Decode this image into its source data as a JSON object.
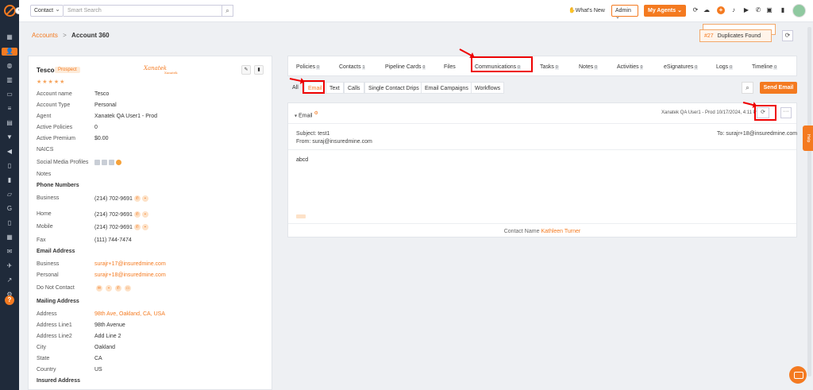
{
  "topbar": {
    "contact_select": "Contact",
    "search_placeholder": "Smart Search",
    "whats_new": "What's New",
    "admin_select": "Admin",
    "my_agents": "My Agents"
  },
  "breadcrumb": {
    "root": "Accounts",
    "sep": ">",
    "current": "Account 360"
  },
  "duplicates": {
    "count": "#27",
    "label": "Duplicates Found"
  },
  "account": {
    "name": "Tesco",
    "status": "Prospect",
    "rating_stars": "★★★★★",
    "logo_text": "Xanatek",
    "logo_sub": "Xanatek",
    "fields": [
      {
        "label": "Account name",
        "value": "Tesco"
      },
      {
        "label": "Account Type",
        "value": "Personal"
      },
      {
        "label": "Agent",
        "value": "Xanatek QA User1 - Prod"
      },
      {
        "label": "Active Policies",
        "value": "0"
      },
      {
        "label": "Active Premium",
        "value": "$0.00"
      },
      {
        "label": "NAICS",
        "value": ""
      },
      {
        "label": "Social Media Profiles",
        "value": ""
      },
      {
        "label": "Notes",
        "value": ""
      }
    ],
    "phone_section": "Phone Numbers",
    "phones": [
      {
        "label": "Business",
        "value": "(214) 702-9691"
      },
      {
        "label": "Home",
        "value": "(214) 702-9691"
      },
      {
        "label": "Mobile",
        "value": "(214) 702-9691"
      },
      {
        "label": "Fax",
        "value": "(111) 744-7474"
      }
    ],
    "email_section": "Email Address",
    "emails": [
      {
        "label": "Business",
        "value": "surajr+17@insuredmine.com"
      },
      {
        "label": "Personal",
        "value": "surajr+18@insuredmine.com"
      },
      {
        "label": "Do Not Contact",
        "value": ""
      }
    ],
    "mailing_section": "Mailing Address",
    "address": [
      {
        "label": "Address",
        "value": "98th Ave, Oakland, CA, USA"
      },
      {
        "label": "Address Line1",
        "value": "98th Avenue"
      },
      {
        "label": "Address Line2",
        "value": "Add Line 2"
      },
      {
        "label": "City",
        "value": "Oakland"
      },
      {
        "label": "State",
        "value": "CA"
      },
      {
        "label": "Country",
        "value": "US"
      }
    ],
    "insured_section": "Insured Address"
  },
  "tabs": [
    {
      "label": "Policies",
      "count": "0"
    },
    {
      "label": "Contacts",
      "count": "1"
    },
    {
      "label": "Pipeline Cards",
      "count": "0"
    },
    {
      "label": "Files",
      "count": ""
    },
    {
      "label": "Communications",
      "count": "0"
    },
    {
      "label": "Tasks",
      "count": "0"
    },
    {
      "label": "Notes",
      "count": "0"
    },
    {
      "label": "Activities",
      "count": "0"
    },
    {
      "label": "eSignatures",
      "count": "0"
    },
    {
      "label": "Logs",
      "count": "0"
    },
    {
      "label": "Timeline",
      "count": "0"
    }
  ],
  "subtabs": [
    "All",
    "Email",
    "Text",
    "Calls",
    "Single Contact Drips",
    "Email Campaigns",
    "Workflows"
  ],
  "send_email": "Send Email",
  "email_card": {
    "title": "Email",
    "meta": "Xanatek QA User1 - Prod 10/17/2024, 4:11 PM",
    "subject": "Subject: test1",
    "from": "From: suraj@insuredmine.com",
    "to": "To: surajr+18@insuredmine.com",
    "body": "abcd",
    "footer_label": "Contact Name",
    "footer_name": "Kathleen Turner"
  },
  "help_side": "Help"
}
